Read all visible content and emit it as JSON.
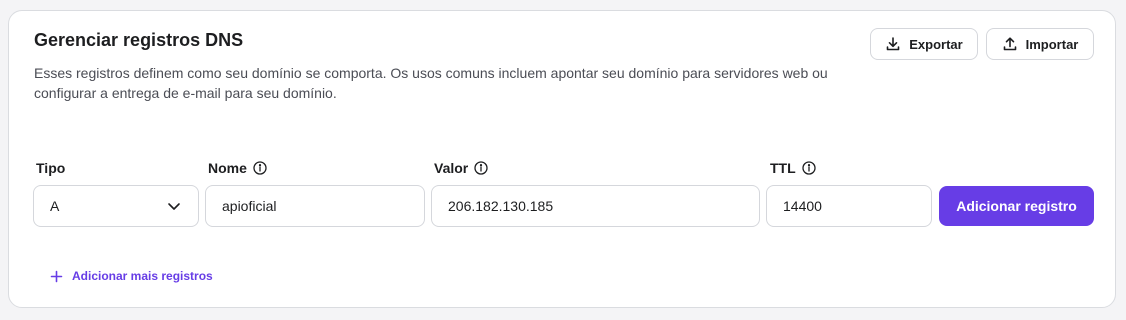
{
  "header": {
    "title": "Gerenciar registros DNS",
    "description": "Esses registros definem como seu domínio se comporta. Os usos comuns incluem apontar seu domínio para servidores web ou configurar a entrega de e-mail para seu domínio."
  },
  "actions": {
    "export_label": "Exportar",
    "export_icon": "download-icon",
    "import_label": "Importar",
    "import_icon": "upload-icon"
  },
  "form": {
    "type": {
      "label": "Tipo",
      "value": "A",
      "icon": "chevron-down-icon"
    },
    "name": {
      "label": "Nome",
      "value": "apioficial",
      "icon": "info-icon"
    },
    "value": {
      "label": "Valor",
      "value": "206.182.130.185",
      "icon": "info-icon"
    },
    "ttl": {
      "label": "TTL",
      "value": "14400",
      "icon": "info-icon"
    },
    "submit_label": "Adicionar registro"
  },
  "add_more": {
    "label": "Adicionar mais registros",
    "icon": "plus-icon"
  },
  "colors": {
    "accent": "#673de6",
    "border": "#d5d7dc",
    "text": "#1d1e20",
    "muted": "#4b4d55"
  }
}
